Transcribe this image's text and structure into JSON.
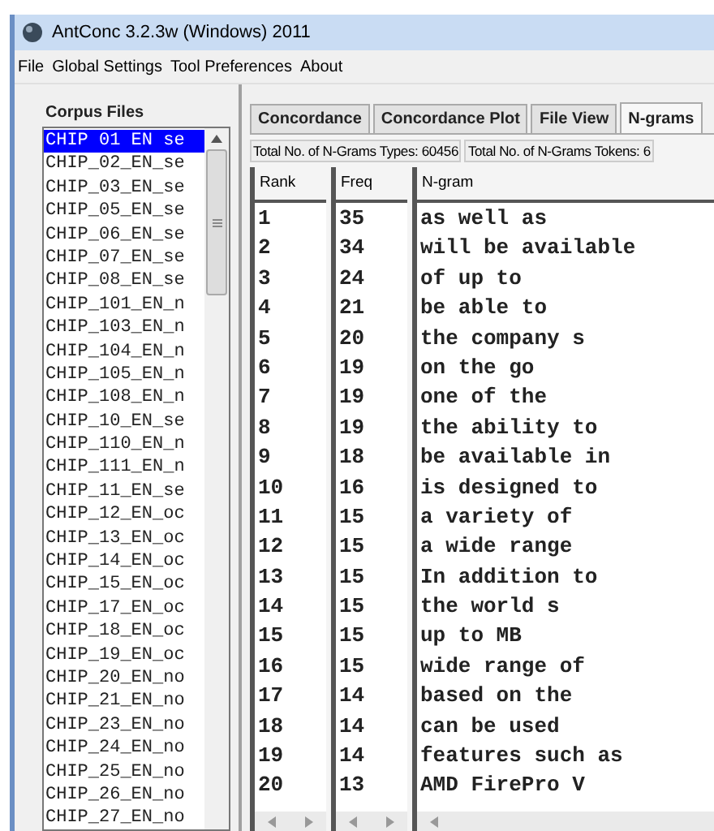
{
  "window": {
    "title": "AntConc 3.2.3w (Windows) 2011"
  },
  "menu": [
    "File",
    "Global Settings",
    "Tool Preferences",
    "About"
  ],
  "corpus_files": {
    "title": "Corpus Files",
    "items": [
      {
        "label": "CHIP 01 EN se",
        "selected": true
      },
      {
        "label": "CHIP_02_EN_se",
        "selected": false
      },
      {
        "label": "CHIP_03_EN_se",
        "selected": false
      },
      {
        "label": "CHIP_05_EN_se",
        "selected": false
      },
      {
        "label": "CHIP_06_EN_se",
        "selected": false
      },
      {
        "label": "CHIP_07_EN_se",
        "selected": false
      },
      {
        "label": "CHIP_08_EN_se",
        "selected": false
      },
      {
        "label": "CHIP_101_EN_n",
        "selected": false
      },
      {
        "label": "CHIP_103_EN_n",
        "selected": false
      },
      {
        "label": "CHIP_104_EN_n",
        "selected": false
      },
      {
        "label": "CHIP_105_EN_n",
        "selected": false
      },
      {
        "label": "CHIP_108_EN_n",
        "selected": false
      },
      {
        "label": "CHIP_10_EN_se",
        "selected": false
      },
      {
        "label": "CHIP_110_EN_n",
        "selected": false
      },
      {
        "label": "CHIP_111_EN_n",
        "selected": false
      },
      {
        "label": "CHIP_11_EN_se",
        "selected": false
      },
      {
        "label": "CHIP_12_EN_oc",
        "selected": false
      },
      {
        "label": "CHIP_13_EN_oc",
        "selected": false
      },
      {
        "label": "CHIP_14_EN_oc",
        "selected": false
      },
      {
        "label": "CHIP_15_EN_oc",
        "selected": false
      },
      {
        "label": "CHIP_17_EN_oc",
        "selected": false
      },
      {
        "label": "CHIP_18_EN_oc",
        "selected": false
      },
      {
        "label": "CHIP_19_EN_oc",
        "selected": false
      },
      {
        "label": "CHIP_20_EN_no",
        "selected": false
      },
      {
        "label": "CHIP_21_EN_no",
        "selected": false
      },
      {
        "label": "CHIP_23_EN_no",
        "selected": false
      },
      {
        "label": "CHIP_24_EN_no",
        "selected": false
      },
      {
        "label": "CHIP_25_EN_no",
        "selected": false
      },
      {
        "label": "CHIP_26_EN_no",
        "selected": false
      },
      {
        "label": "CHIP_27_EN_no",
        "selected": false
      }
    ]
  },
  "tabs": [
    {
      "label": "Concordance",
      "selected": false
    },
    {
      "label": "Concordance Plot",
      "selected": false
    },
    {
      "label": "File View",
      "selected": false
    },
    {
      "label": "N-grams",
      "selected": true
    }
  ],
  "stats": [
    "Total No. of N-Grams Types: 60456",
    "Total No. of N-Grams Tokens: 6"
  ],
  "table": {
    "columns": [
      "Rank",
      "Freq",
      "N-gram"
    ],
    "rows": [
      [
        "1",
        "35",
        "as well as"
      ],
      [
        "2",
        "34",
        "will be available"
      ],
      [
        "3",
        "24",
        "of up to"
      ],
      [
        "4",
        "21",
        "be able to"
      ],
      [
        "5",
        "20",
        "the company s"
      ],
      [
        "6",
        "19",
        "on the go"
      ],
      [
        "7",
        "19",
        "one of the"
      ],
      [
        "8",
        "19",
        "the ability to"
      ],
      [
        "9",
        "18",
        "be available in"
      ],
      [
        "10",
        "16",
        "is designed to"
      ],
      [
        "11",
        "15",
        "a variety of"
      ],
      [
        "12",
        "15",
        "a wide range"
      ],
      [
        "13",
        "15",
        "In addition to"
      ],
      [
        "14",
        "15",
        "the world s"
      ],
      [
        "15",
        "15",
        "up to MB"
      ],
      [
        "16",
        "15",
        "wide range of"
      ],
      [
        "17",
        "14",
        "based on the"
      ],
      [
        "18",
        "14",
        "can be used"
      ],
      [
        "19",
        "14",
        "features such as"
      ],
      [
        "20",
        "13",
        "AMD FirePro V"
      ]
    ]
  }
}
